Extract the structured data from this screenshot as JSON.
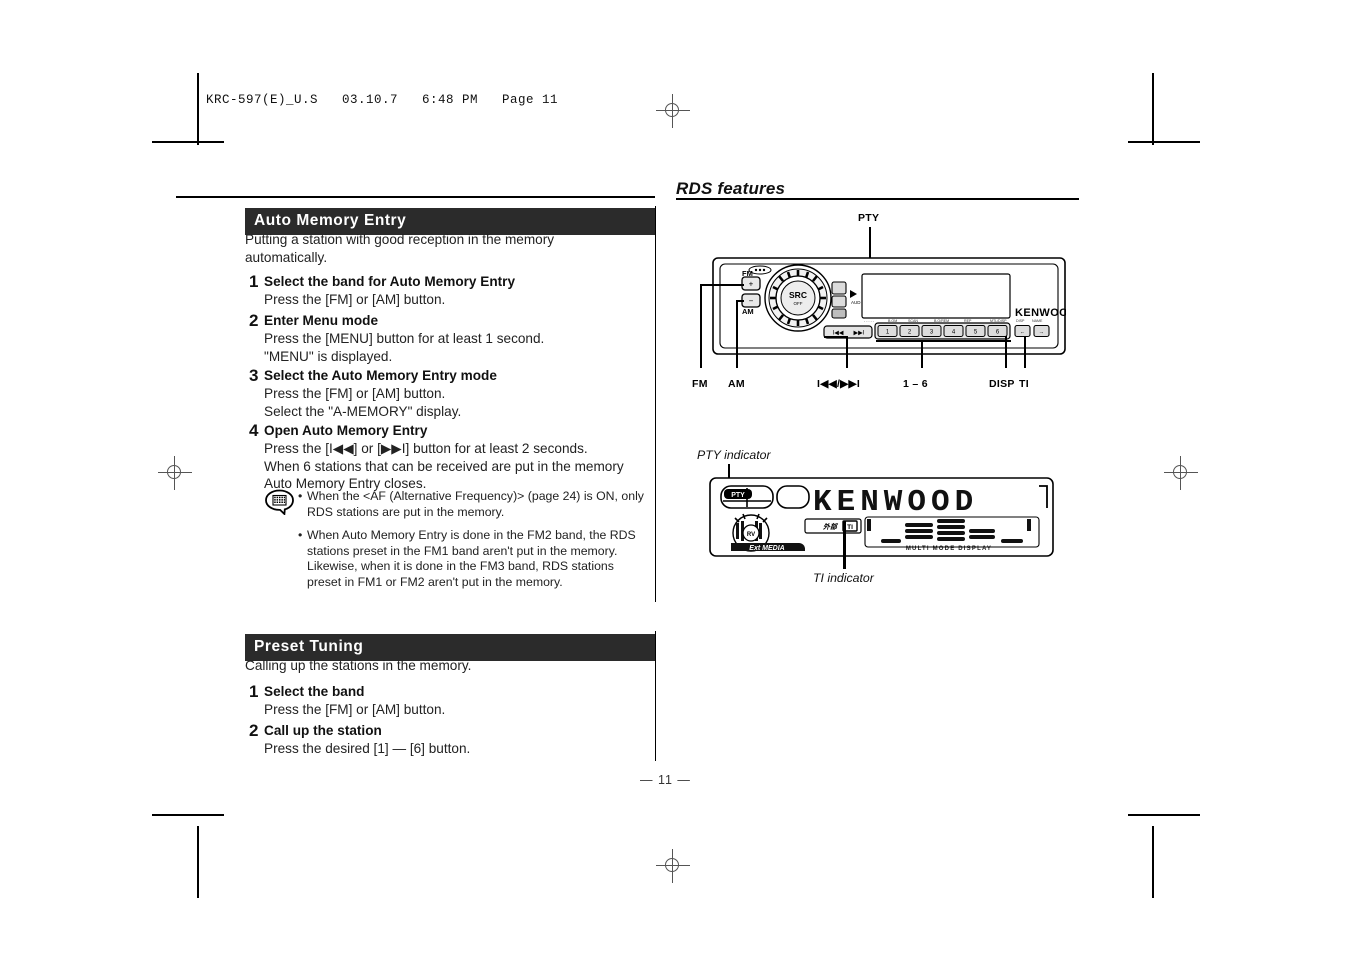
{
  "print_header": "KRC-597(E)_U.S   03.10.7   6:48 PM   Page 11",
  "page_number": "— 11 —",
  "left_column": {
    "sections": [
      {
        "heading": "Auto Memory Entry",
        "lead": "Putting a station with good reception in the memory automatically.",
        "steps": [
          {
            "num": "1",
            "title": "Select the band for Auto Memory Entry",
            "lines": [
              "Press the [FM] or [AM] button."
            ]
          },
          {
            "num": "2",
            "title": "Enter Menu mode",
            "lines": [
              "Press the [MENU] button for at least 1 second.",
              "\"MENU\" is displayed."
            ]
          },
          {
            "num": "3",
            "title": "Select the Auto Memory Entry mode",
            "lines": [
              "Press the [FM] or [AM] button.",
              "Select the \"A-MEMORY\" display."
            ]
          },
          {
            "num": "4",
            "title": "Open Auto Memory Entry",
            "lines": [
              "Press the [I◀◀] or [▶▶I] button for at least 2 seconds.",
              "When 6 stations that can be received are put in the memory",
              "Auto Memory Entry closes."
            ]
          }
        ],
        "note": {
          "icon": "note-bubble-icon",
          "bullets": [
            "When the <AF (Alternative Frequency)> (page 24) is ON, only RDS stations are put in the memory.",
            "When Auto Memory Entry is done in the FM2 band, the RDS stations preset in the FM1 band aren't put in the memory. Likewise, when it is done in the FM3 band, RDS stations preset in FM1 or FM2 aren't put in the memory."
          ]
        }
      },
      {
        "heading": "Preset Tuning",
        "lead": "Calling up the stations in the memory.",
        "steps": [
          {
            "num": "1",
            "title": "Select the band",
            "lines": [
              "Press the [FM] or [AM] button."
            ]
          },
          {
            "num": "2",
            "title": "Call up the station",
            "lines": [
              "Press the desired [1] — [6] button."
            ]
          }
        ]
      }
    ]
  },
  "right_column": {
    "title": "RDS features",
    "top_callout": "PTY",
    "button_labels": [
      "FM",
      "AM",
      "I◀◀/▶▶I",
      "1 – 6",
      "DISP",
      "TI"
    ],
    "display_callouts": {
      "pty": "PTY indicator",
      "ti": "TI indicator"
    },
    "faceplate": {
      "brand": "KENWOOD",
      "source_knob": "SRC",
      "preset_keys": [
        "1",
        "2",
        "3",
        "4",
        "5",
        "6"
      ],
      "band_up": "FM",
      "band_down": "AM",
      "small_labels": [
        "SCAN",
        "B.O/REM",
        "REP",
        "MTL/DISP",
        "DISP",
        "NAME"
      ]
    },
    "lcd": {
      "text": "KENWOOD",
      "pty_badge": "PTY",
      "ti_badge": "TI",
      "ext_media": "Ext MEDIA",
      "multi_mode": "MULTI MODE DISPLAY"
    }
  }
}
